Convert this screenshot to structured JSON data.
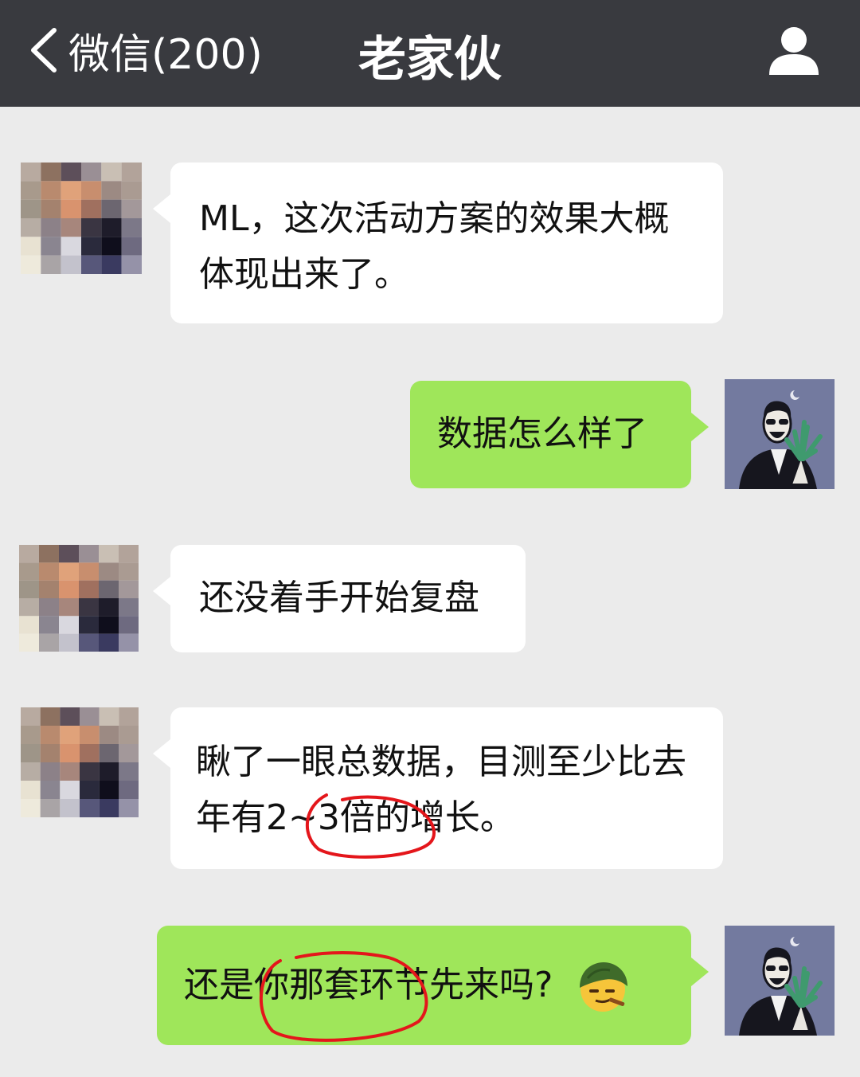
{
  "header": {
    "back_label": "微信(200)",
    "title": "老家伙"
  },
  "messages": [
    {
      "side": "left",
      "text": "ML，这次活动方案的效果大概体现出来了。"
    },
    {
      "side": "right",
      "text": "数据怎么样了"
    },
    {
      "side": "left",
      "text": "还没着手开始复盘"
    },
    {
      "side": "left",
      "text_before": "瞅了一眼总数据，目测至少比去年有",
      "highlight": "2~3倍",
      "text_after": "的增长。"
    },
    {
      "side": "right",
      "text_before": "还是",
      "highlight": "你那套环节",
      "text_after": "先来吗?",
      "emoji": "smirk-emoji-icon"
    }
  ],
  "colors": {
    "header_bg": "#393a3f",
    "chat_bg": "#ebebeb",
    "bubble_left": "#ffffff",
    "bubble_right": "#9fe65a",
    "highlight_circle": "#e4161b"
  }
}
